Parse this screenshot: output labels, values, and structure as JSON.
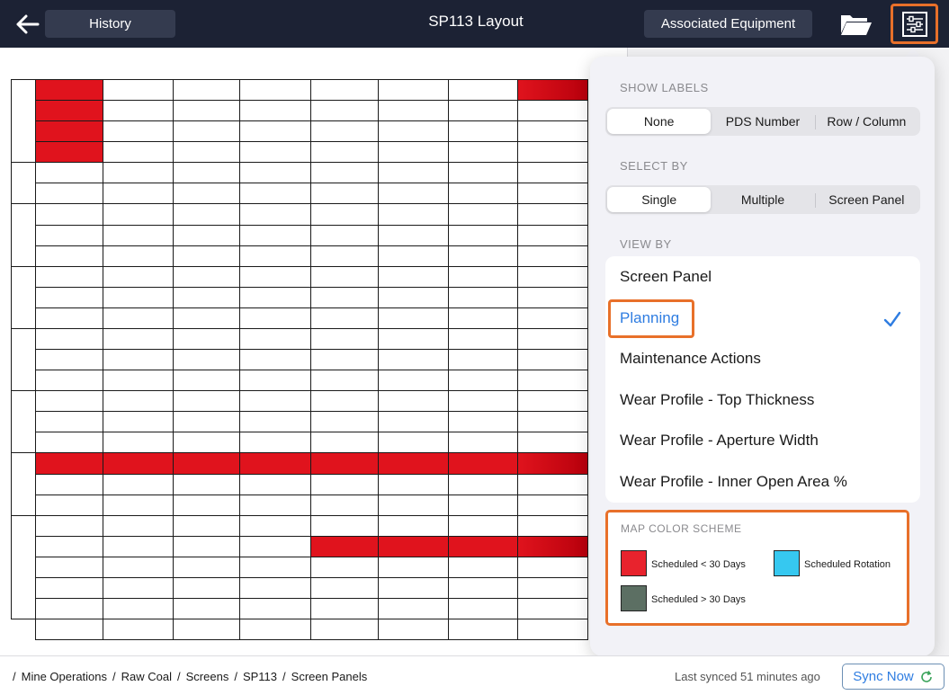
{
  "header": {
    "history_label": "History",
    "title": "SP113 Layout",
    "associated_equipment_label": "Associated Equipment"
  },
  "popover": {
    "show_labels": {
      "heading": "SHOW LABELS",
      "options": [
        "None",
        "PDS Number",
        "Row / Column"
      ],
      "selected": "None"
    },
    "select_by": {
      "heading": "SELECT BY",
      "options": [
        "Single",
        "Multiple",
        "Screen Panel"
      ],
      "selected": "Single"
    },
    "view_by": {
      "heading": "VIEW BY",
      "items": [
        "Screen Panel",
        "Planning",
        "Maintenance Actions",
        "Wear Profile - Top Thickness",
        "Wear Profile - Aperture Width",
        "Wear Profile - Inner Open Area %"
      ],
      "selected": "Planning"
    },
    "color_scheme": {
      "heading": "MAP COLOR SCHEME",
      "entries": [
        {
          "label": "Scheduled < 30 Days",
          "color": "#e8232d"
        },
        {
          "label": "Scheduled Rotation",
          "color": "#36c8f0"
        },
        {
          "label": "Scheduled > 30 Days",
          "color": "#5c6f63"
        }
      ]
    }
  },
  "layout_grid": {
    "columns": 8,
    "rows": 27,
    "panel_groups_rows": [
      4,
      2,
      3,
      3,
      3,
      3,
      3,
      5
    ],
    "scheduled_cells": [
      {
        "row": 0,
        "col": 1
      },
      {
        "row": 0,
        "col": 8
      },
      {
        "row": 1,
        "col": 1
      },
      {
        "row": 2,
        "col": 1
      },
      {
        "row": 3,
        "col": 1
      },
      {
        "row": 18,
        "col": 1
      },
      {
        "row": 18,
        "col": 2
      },
      {
        "row": 18,
        "col": 3
      },
      {
        "row": 18,
        "col": 4
      },
      {
        "row": 18,
        "col": 5
      },
      {
        "row": 18,
        "col": 6
      },
      {
        "row": 18,
        "col": 7
      },
      {
        "row": 18,
        "col": 8
      },
      {
        "row": 22,
        "col": 5
      },
      {
        "row": 22,
        "col": 6
      },
      {
        "row": 22,
        "col": 7
      },
      {
        "row": 22,
        "col": 8
      }
    ]
  },
  "footer": {
    "breadcrumbs": [
      "Mine Operations",
      "Raw Coal",
      "Screens",
      "SP113",
      "Screen Panels"
    ],
    "sync_status": "Last synced 51 minutes ago",
    "sync_button": "Sync Now"
  },
  "colors": {
    "topbar": "#1c2234",
    "accent_orange": "#e8702a",
    "link_blue": "#2f7de1",
    "scheduled_red": "#e0131d"
  }
}
